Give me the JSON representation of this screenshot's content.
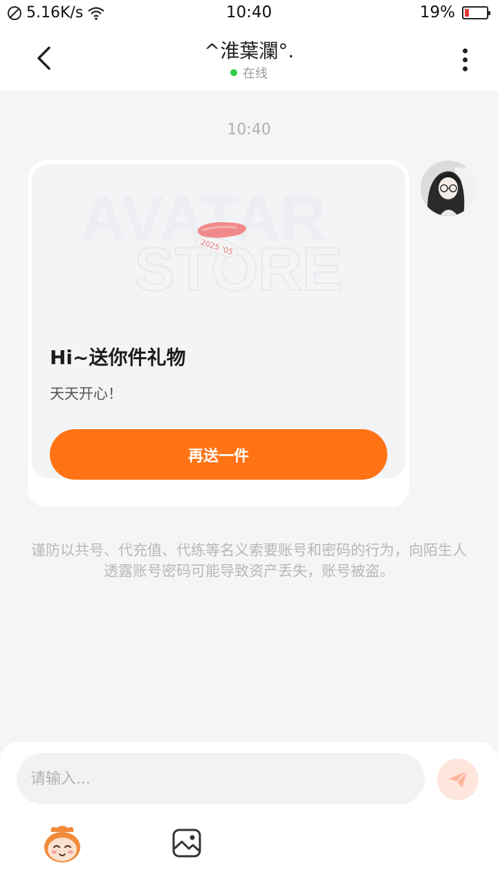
{
  "status_bar": {
    "speed": "5.16K/s",
    "time": "10:40",
    "battery": "19%"
  },
  "header": {
    "title": "^淮葉瀾°.",
    "status": "在线"
  },
  "chat": {
    "timestamp": "10:40",
    "gift_card": {
      "title": "Hi~送你件礼物",
      "subtitle": "天天开心！",
      "button_label": "再送一件",
      "watermark_line1": "AVATAR",
      "watermark_line2": "STORE",
      "item_label": "2025 '05"
    },
    "warning": "谨防以共号、代充值、代练等名义索要账号和密码的行为，向陌生人透露账号密码可能导致资产丢失，账号被盗。"
  },
  "input": {
    "placeholder": "请输入..."
  },
  "colors": {
    "accent": "#ff7314",
    "online": "#2ecc40",
    "background": "#f3f5f7"
  }
}
